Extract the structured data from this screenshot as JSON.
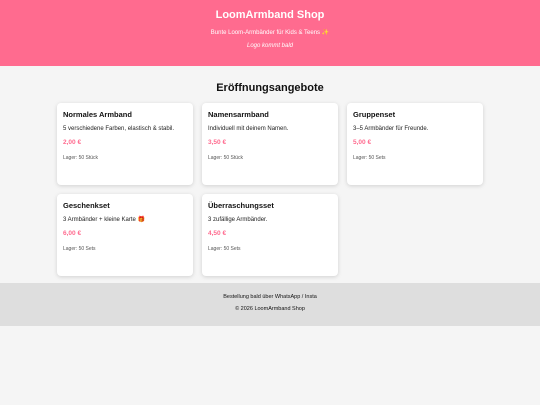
{
  "header": {
    "title": "LoomArmband Shop",
    "subtitle": "Bunte Loom-Armbänder für Kids & Teens ✨",
    "logo_note": "Logo kommt bald"
  },
  "offers": {
    "title": "Eröffnungsangebote",
    "products": [
      {
        "name": "Normales Armband",
        "description": "5 verschiedene Farben, elastisch & stabil.",
        "price": "2,00 €",
        "stock": "Lager: 50 Stück"
      },
      {
        "name": "Namensarmband",
        "description": "Individuell mit deinem Namen.",
        "price": "3,50 €",
        "stock": "Lager: 50 Stück"
      },
      {
        "name": "Gruppenset",
        "description": "3–5 Armbänder für Freunde.",
        "price": "5,00 €",
        "stock": "Lager: 50 Sets"
      },
      {
        "name": "Geschenkset",
        "description": "3 Armbänder + kleine Karte 🎁",
        "price": "6,00 €",
        "stock": "Lager: 50 Sets"
      },
      {
        "name": "Überraschungsset",
        "description": "3 zufällige Armbänder.",
        "price": "4,50 €",
        "stock": "Lager: 50 Sets"
      }
    ]
  },
  "footer": {
    "order_note": "Bestellung bald über WhatsApp / Insta",
    "copyright": "© 2026 LoomArmband Shop"
  },
  "colors": {
    "accent": "#ff6b8f",
    "background": "#f5f5f5",
    "footer_bg": "#dedede"
  }
}
